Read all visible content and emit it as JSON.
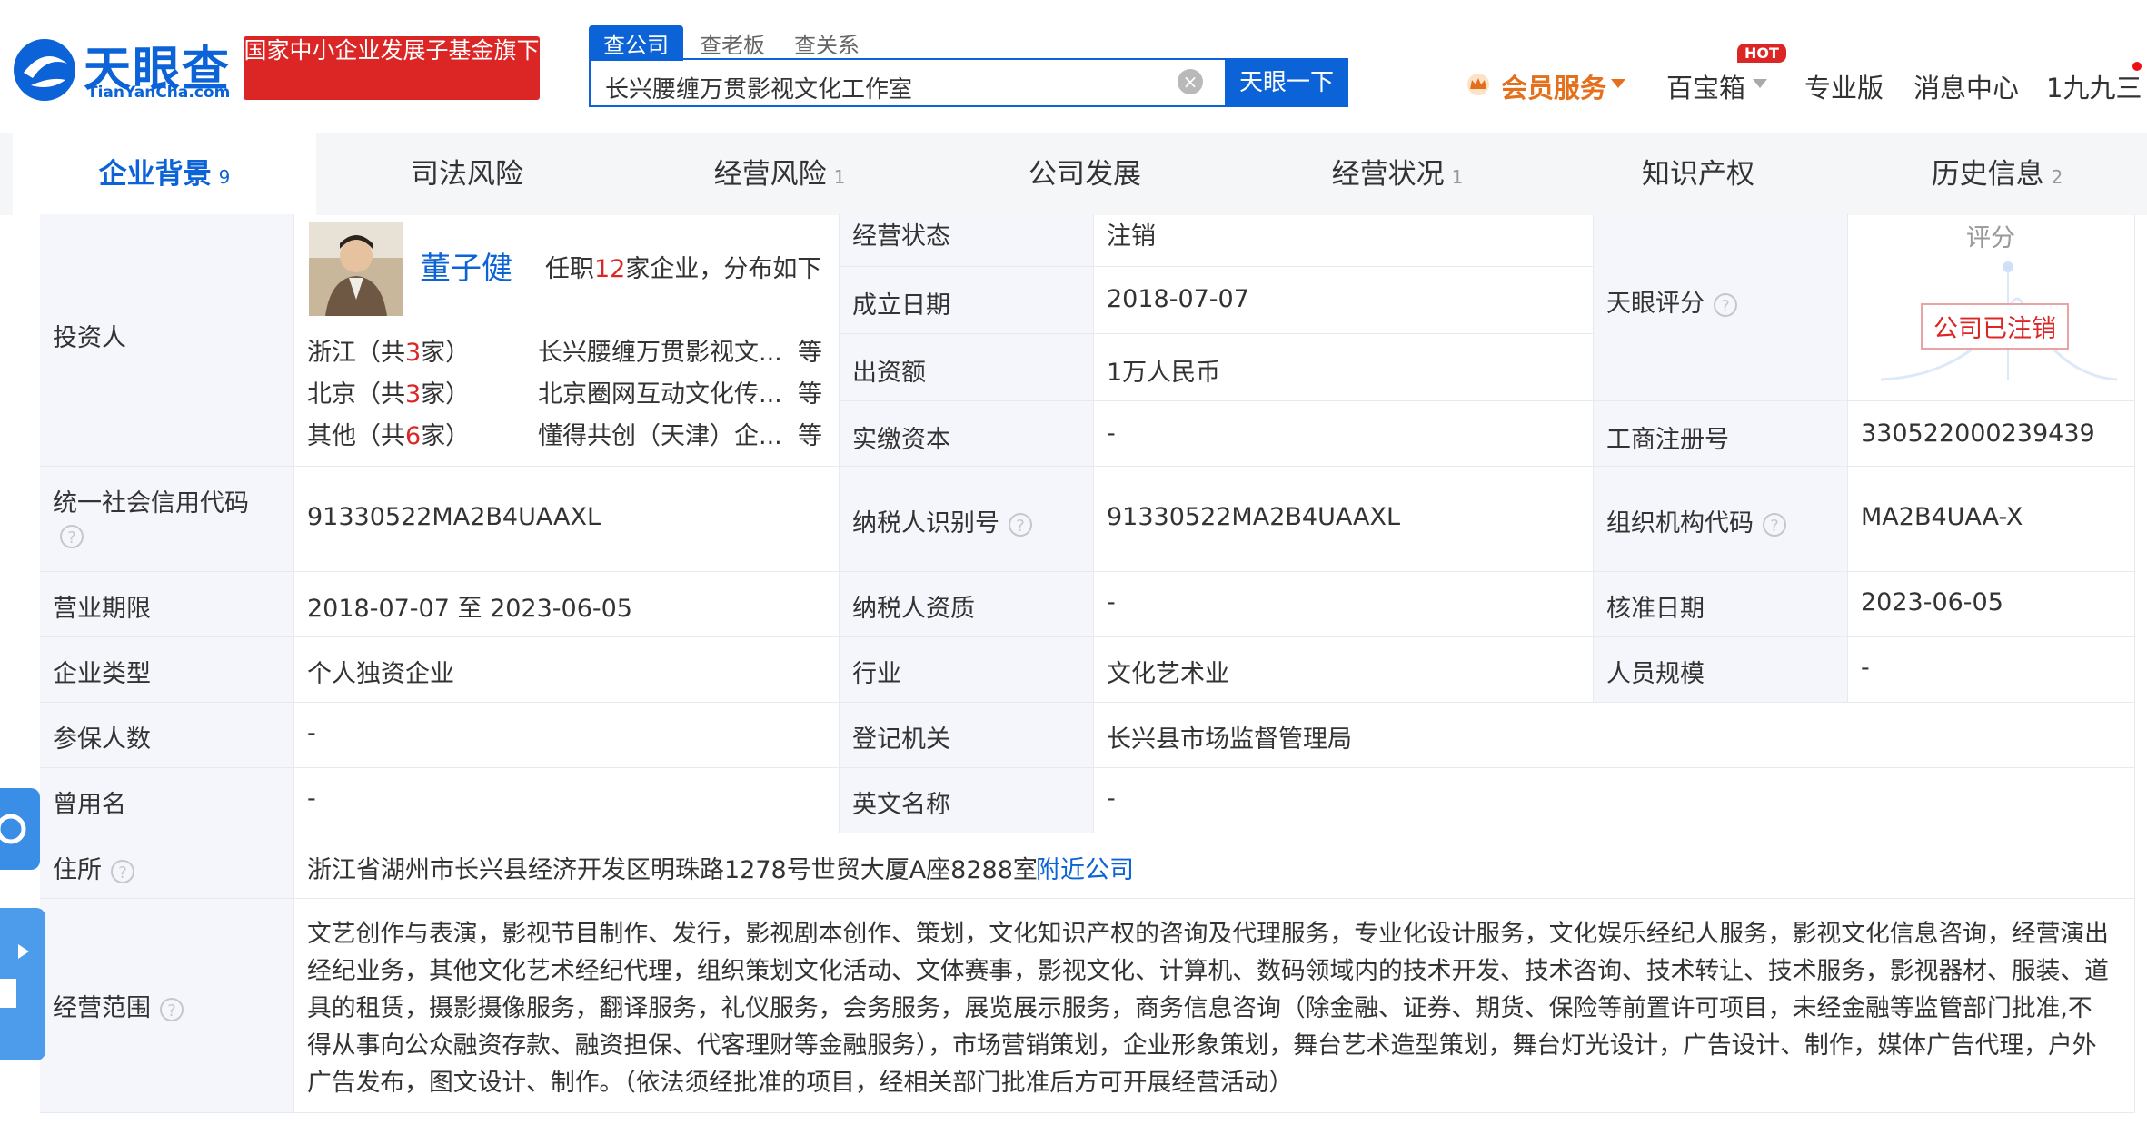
{
  "header": {
    "logo_title": "天眼查",
    "logo_sub": "TianYanCha.com",
    "promo": "国家中小企业发展子基金旗下",
    "search_tabs": [
      "查公司",
      "查老板",
      "查关系"
    ],
    "search_value": "长兴腰缠万贯影视文化工作室",
    "search_button": "天眼一下",
    "nav": {
      "vip": "会员服务",
      "hot": "HOT",
      "baibao": "百宝箱",
      "pro": "专业版",
      "msg": "消息中心",
      "user": "1九九三"
    }
  },
  "tabs": [
    {
      "label": "企业背景",
      "count": "9"
    },
    {
      "label": "司法风险",
      "count": ""
    },
    {
      "label": "经营风险",
      "count": "1"
    },
    {
      "label": "公司发展",
      "count": ""
    },
    {
      "label": "经营状况",
      "count": "1"
    },
    {
      "label": "知识产权",
      "count": ""
    },
    {
      "label": "历史信息",
      "count": "2"
    }
  ],
  "investor": {
    "label": "投资人",
    "name": "董子健",
    "summary_pre": "任职",
    "summary_count": "12",
    "summary_post": "家企业，分布如下",
    "regions": [
      {
        "region_pre": "浙江（共",
        "count": "3",
        "region_post": "家）",
        "companies": "长兴腰缠万贯影视文...",
        "more": "等"
      },
      {
        "region_pre": "北京（共",
        "count": "3",
        "region_post": "家）",
        "companies": "北京圈网互动文化传...",
        "more": "等"
      },
      {
        "region_pre": "其他（共",
        "count": "6",
        "region_post": "家）",
        "companies": "懂得共创（天津）企...",
        "more": "等"
      }
    ]
  },
  "fields": {
    "status_label": "经营状态",
    "status": "注销",
    "founded_label": "成立日期",
    "founded": "2018-07-07",
    "capital_label": "出资额",
    "capital": "1万人民币",
    "paid_label": "实缴资本",
    "paid": "-",
    "score_label": "天眼评分",
    "score_title": "评分",
    "score_stamp": "公司已注销",
    "reg_no_label": "工商注册号",
    "reg_no": "330522000239439",
    "credit_label": "统一社会信用代码",
    "credit": "91330522MA2B4UAAXL",
    "tax_id_label": "纳税人识别号",
    "tax_id": "91330522MA2B4UAAXL",
    "org_code_label": "组织机构代码",
    "org_code": "MA2B4UAA-X",
    "term_label": "营业期限",
    "term": "2018-07-07 至 2023-06-05",
    "tax_qual_label": "纳税人资质",
    "tax_qual": "-",
    "approve_label": "核准日期",
    "approve": "2023-06-05",
    "type_label": "企业类型",
    "type": "个人独资企业",
    "industry_label": "行业",
    "industry": "文化艺术业",
    "staff_label": "人员规模",
    "staff": "-",
    "insured_label": "参保人数",
    "insured": "-",
    "reg_auth_label": "登记机关",
    "reg_auth": "长兴县市场监督管理局",
    "former_label": "曾用名",
    "former": "-",
    "en_label": "英文名称",
    "en": "-",
    "address_label": "住所",
    "address": "浙江省湖州市长兴县经济开发区明珠路1278号世贸大厦A座8288室",
    "nearby": "附近公司",
    "scope_label": "经营范围",
    "scope": "文艺创作与表演，影视节目制作、发行，影视剧本创作、策划，文化知识产权的咨询及代理服务，专业化设计服务，文化娱乐经纪人服务，影视文化信息咨询，经营演出经纪业务，其他文化艺术经纪代理，组织策划文化活动、文体赛事，影视文化、计算机、数码领域内的技术开发、技术咨询、技术转让、技术服务，影视器材、服装、道具的租赁，摄影摄像服务，翻译服务，礼仪服务，会务服务，展览展示服务，商务信息咨询（除金融、证券、期货、保险等前置许可项目，未经金融等监管部门批准,不得从事向公众融资存款、融资担保、代客理财等金融服务），市场营销策划，企业形象策划，舞台艺术造型策划，舞台灯光设计，广告设计、制作，媒体广告代理，户外广告发布，图文设计、制作。（依法须经批准的项目，经相关部门批准后方可开展经营活动）"
  },
  "colors": {
    "brand": "#0c63d7",
    "promo": "#dc2626",
    "label_bg": "#f5f6fb",
    "vip": "#e4701d"
  }
}
